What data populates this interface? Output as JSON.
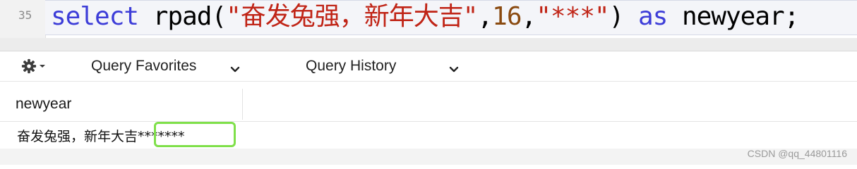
{
  "editor": {
    "line_number": "35",
    "tokens": [
      {
        "text": "select",
        "kind": "kw"
      },
      {
        "text": " ",
        "kind": "pun"
      },
      {
        "text": "rpad",
        "kind": "fn"
      },
      {
        "text": "(",
        "kind": "pun"
      },
      {
        "text": "\"奋发兔强，新年大吉\"",
        "kind": "str"
      },
      {
        "text": ",",
        "kind": "pun"
      },
      {
        "text": "16",
        "kind": "num"
      },
      {
        "text": ",",
        "kind": "pun"
      },
      {
        "text": "\"***\"",
        "kind": "str"
      },
      {
        "text": ") ",
        "kind": "pun"
      },
      {
        "text": "as",
        "kind": "kw"
      },
      {
        "text": " newyear;",
        "kind": "fn"
      }
    ]
  },
  "toolbar": {
    "gear_icon": "gear-icon",
    "favorites_label": "Query Favorites",
    "history_label": "Query History"
  },
  "results": {
    "columns": [
      "newyear"
    ],
    "rows": [
      {
        "value": "奋发兔强，新年大吉*******"
      }
    ]
  },
  "colors": {
    "keyword": "#3d3dd8",
    "string": "#c02416",
    "number": "#8a4a10",
    "highlight": "#7fe04a"
  },
  "watermark": "CSDN @qq_44801116"
}
